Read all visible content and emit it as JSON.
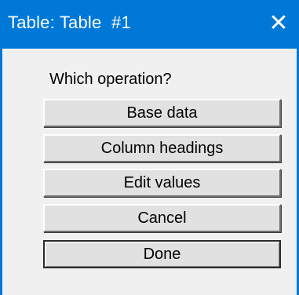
{
  "window": {
    "title": "Table: Table  #1",
    "close_glyph": "✕"
  },
  "prompt": "Which operation?",
  "buttons": [
    {
      "label": "Base data"
    },
    {
      "label": "Column headings"
    },
    {
      "label": "Edit values"
    },
    {
      "label": "Cancel"
    },
    {
      "label": "Done",
      "default": true
    }
  ],
  "colors": {
    "titlebar": "#0078d7",
    "face": "#f0f0f0",
    "button": "#e1e1e1"
  }
}
